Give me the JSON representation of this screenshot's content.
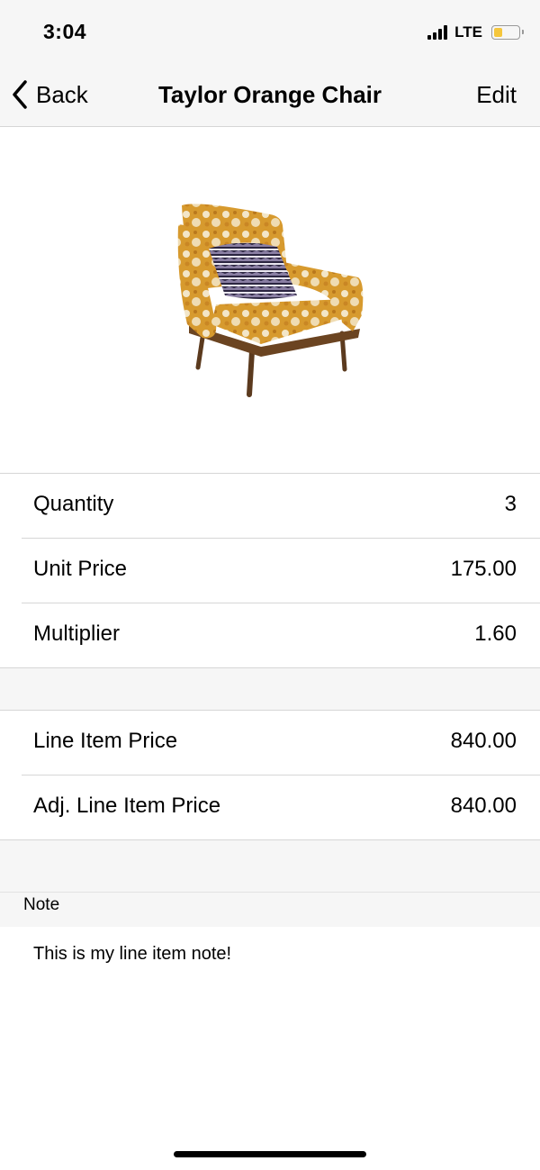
{
  "status_bar": {
    "time": "3:04",
    "network": "LTE",
    "battery_level": 0.35,
    "battery_color": "#f5c63c"
  },
  "nav": {
    "back_label": "Back",
    "title": "Taylor Orange Chair",
    "edit_label": "Edit"
  },
  "product_image": {
    "icon": "chair-photo"
  },
  "pricing": [
    {
      "label": "Quantity",
      "value": "3"
    },
    {
      "label": "Unit Price",
      "value": "175.00"
    },
    {
      "label": "Multiplier",
      "value": "1.60"
    }
  ],
  "totals": [
    {
      "label": "Line Item Price",
      "value": "840.00"
    },
    {
      "label": "Adj. Line Item Price",
      "value": "840.00"
    }
  ],
  "note": {
    "header": "Note",
    "text": "This is my line item note!"
  }
}
